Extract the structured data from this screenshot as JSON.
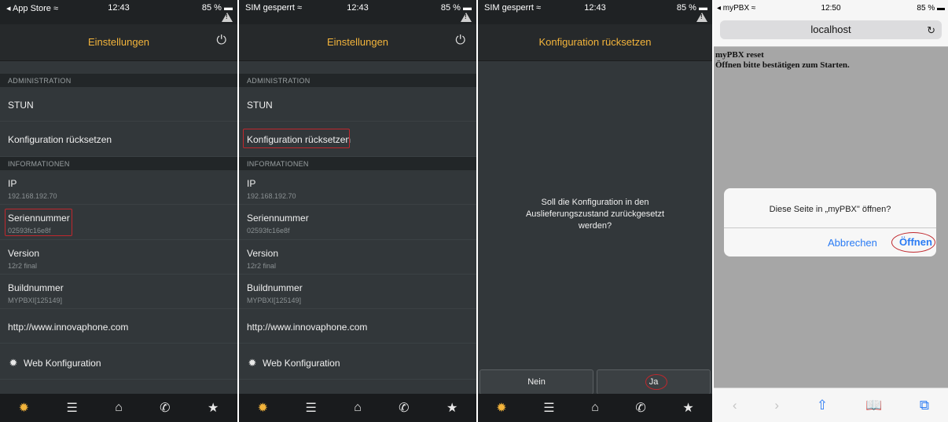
{
  "screen1": {
    "status": {
      "left": "◂ App Store ≈",
      "time": "12:43",
      "battery": "85 % ▬"
    },
    "title": "Einstellungen",
    "sections": {
      "admin": "ADMINISTRATION",
      "info": "INFORMATIONEN"
    },
    "rows": {
      "stun": "STUN",
      "config_reset": "Konfiguration rücksetzen",
      "ip_label": "IP",
      "ip_value": "192.168.192.70",
      "serial_label": "Seriennummer",
      "serial_value": "02593fc16e8f",
      "version_label": "Version",
      "version_value": "12r2 final",
      "build_label": "Buildnummer",
      "build_value": "MYPBXI[125149]",
      "url": "http://www.innovaphone.com",
      "web_config": "Web Konfiguration"
    }
  },
  "screen2": {
    "status": {
      "left": "SIM gesperrt ≈",
      "time": "12:43",
      "battery": "85 % ▬"
    },
    "title": "Einstellungen",
    "sections": {
      "admin": "ADMINISTRATION",
      "info": "INFORMATIONEN"
    },
    "rows": {
      "stun": "STUN",
      "config_reset": "Konfiguration rücksetzen",
      "ip_label": "IP",
      "ip_value": "192.168.192.70",
      "serial_label": "Seriennummer",
      "serial_value": "02593fc16e8f",
      "version_label": "Version",
      "version_value": "12r2 final",
      "build_label": "Buildnummer",
      "build_value": "MYPBXI[125149]",
      "url": "http://www.innovaphone.com",
      "web_config": "Web Konfiguration"
    }
  },
  "screen3": {
    "status": {
      "left": "SIM gesperrt ≈",
      "time": "12:43",
      "battery": "85 % ▬"
    },
    "title": "Konfiguration rücksetzen",
    "question": "Soll die Konfiguration in den Auslieferungszustand zurückgesetzt werden?",
    "no_label": "Nein",
    "yes_label": "Ja"
  },
  "screen4": {
    "status": {
      "left": "◂ myPBX ≈",
      "time": "12:50",
      "battery": "85 % ▬"
    },
    "url": "localhost",
    "page_line1": "myPBX reset",
    "page_line2": "Öffnen bitte bestätigen zum Starten.",
    "alert_message": "Diese Seite in „myPBX\" öffnen?",
    "cancel_label": "Abbrechen",
    "open_label": "Öffnen"
  },
  "colors": {
    "accent": "#f3b43b",
    "highlight": "#c0272d",
    "ios_blue": "#2a7bf4"
  }
}
